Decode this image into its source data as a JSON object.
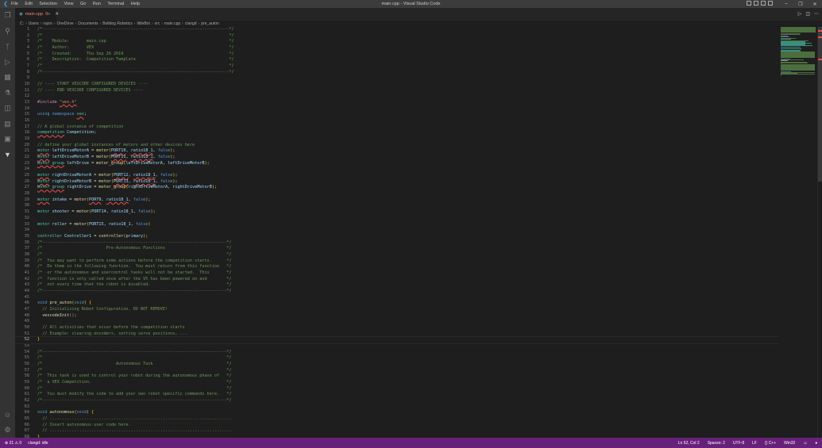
{
  "titlebar": {
    "title": "main.cpp - Visual Studio Code",
    "menu": [
      "File",
      "Edit",
      "Selection",
      "View",
      "Go",
      "Run",
      "Terminal",
      "Help"
    ]
  },
  "tab": {
    "label": "main.cpp",
    "badge": "9+"
  },
  "breadcrumb": [
    "C:",
    "Users",
    "rayro",
    "OneDrive",
    "Documents",
    "Bolldog Robotics",
    "littleBot",
    "src",
    "main.cpp",
    "clangd",
    "pre_auton"
  ],
  "status": {
    "errors": "21",
    "warnings": "0",
    "clangd": "clangd: idle",
    "position": "Ln 52, Col 2",
    "spaces": "Spaces: 2",
    "encoding": "UTF-8",
    "eol": "LF",
    "language": "C++",
    "platform": "Win32"
  },
  "editor": {
    "current_line": 52,
    "lines": [
      [
        [
          "c",
          "/*----------------------------------------------------------------------------*/"
        ]
      ],
      [
        [
          "c",
          "/*                                                                            */"
        ]
      ],
      [
        [
          "c",
          "/*    Module:       main.cpp                                                  */"
        ]
      ],
      [
        [
          "c",
          "/*    Author:       VEX                                                       */"
        ]
      ],
      [
        [
          "c",
          "/*    Created:      Thu Sep 26 2019                                           */"
        ]
      ],
      [
        [
          "c",
          "/*    Description:  Competition Template                                      */"
        ]
      ],
      [
        [
          "c",
          "/*                                                                            */"
        ]
      ],
      [
        [
          "c",
          "/*----------------------------------------------------------------------------*/"
        ]
      ],
      [],
      [
        [
          "c",
          "// ---- START VEXCODE CONFIGURED DEVICES ----"
        ]
      ],
      [
        [
          "c",
          "// ---- END VEXCODE CONFIGURED DEVICES ----"
        ]
      ],
      [],
      [
        [
          "m",
          "#include "
        ],
        [
          "s e",
          "\"vex.h\""
        ]
      ],
      [],
      [
        [
          "k",
          "using namespace "
        ],
        [
          "t e",
          "vex"
        ],
        [
          "p",
          ";"
        ]
      ],
      [],
      [
        [
          "c",
          "// A global instance of competition"
        ]
      ],
      [
        [
          "t e",
          "competition"
        ],
        [
          "p",
          " "
        ],
        [
          "v",
          "Competition"
        ],
        [
          "p",
          ";"
        ]
      ],
      [],
      [
        [
          "c",
          "// define your global instances of motors and other devices here"
        ]
      ],
      [
        [
          "t e",
          "motor"
        ],
        [
          "v",
          " leftDriveMotorA"
        ],
        [
          "p",
          " = "
        ],
        [
          "f",
          "motor"
        ],
        [
          "b",
          "("
        ],
        [
          "v e",
          "PORT10"
        ],
        [
          "p",
          ", "
        ],
        [
          "v e",
          "ratio18_1"
        ],
        [
          "p",
          ", "
        ],
        [
          "k",
          "false"
        ],
        [
          "b",
          ")"
        ],
        [
          "p",
          ";"
        ]
      ],
      [
        [
          "t e",
          "motor"
        ],
        [
          "v",
          " leftDriveMotorB"
        ],
        [
          "p",
          " = "
        ],
        [
          "f",
          "motor"
        ],
        [
          "b",
          "("
        ],
        [
          "v e",
          "PORT11"
        ],
        [
          "p",
          ", "
        ],
        [
          "v e",
          "ratio18_1"
        ],
        [
          "p",
          ", "
        ],
        [
          "k",
          "false"
        ],
        [
          "b",
          ")"
        ],
        [
          "p",
          ";"
        ]
      ],
      [
        [
          "t e",
          "motor_group"
        ],
        [
          "v",
          " leftDrive"
        ],
        [
          "p",
          " = "
        ],
        [
          "f",
          "motor_group"
        ],
        [
          "b",
          "("
        ],
        [
          "v",
          "leftDriveMotorA"
        ],
        [
          "p",
          ", "
        ],
        [
          "v",
          "leftDriveMotorB"
        ],
        [
          "b",
          ")"
        ],
        [
          "p",
          ";"
        ]
      ],
      [],
      [
        [
          "t e",
          "motor"
        ],
        [
          "v",
          " rightDriveMotorA"
        ],
        [
          "p",
          " = "
        ],
        [
          "f",
          "motor"
        ],
        [
          "b",
          "("
        ],
        [
          "v e",
          "PORT12"
        ],
        [
          "p",
          ", "
        ],
        [
          "v e",
          "ratio18_1"
        ],
        [
          "p",
          ", "
        ],
        [
          "k",
          "false"
        ],
        [
          "b",
          ")"
        ],
        [
          "p",
          ";"
        ]
      ],
      [
        [
          "t e",
          "motor"
        ],
        [
          "v",
          " rightDriveMotorB"
        ],
        [
          "p",
          " = "
        ],
        [
          "f",
          "motor"
        ],
        [
          "b",
          "("
        ],
        [
          "v e",
          "PORT13"
        ],
        [
          "p",
          ", "
        ],
        [
          "v e",
          "ratio18_1"
        ],
        [
          "p",
          ", "
        ],
        [
          "k",
          "false"
        ],
        [
          "b",
          ")"
        ],
        [
          "p",
          ";"
        ]
      ],
      [
        [
          "t e",
          "motor_group"
        ],
        [
          "v",
          " rightDrive"
        ],
        [
          "p",
          " = "
        ],
        [
          "f",
          "motor_group"
        ],
        [
          "b",
          "("
        ],
        [
          "v",
          "rightDriveMotorA"
        ],
        [
          "p",
          ", "
        ],
        [
          "v",
          "rightDriveMotorB"
        ],
        [
          "b",
          ")"
        ],
        [
          "p",
          ";"
        ]
      ],
      [],
      [
        [
          "t e",
          "motor"
        ],
        [
          "v",
          " intake"
        ],
        [
          "p",
          " = "
        ],
        [
          "f",
          "motor"
        ],
        [
          "b",
          "("
        ],
        [
          "v e",
          "PORT9"
        ],
        [
          "p",
          ", "
        ],
        [
          "v e",
          "ratio18_1"
        ],
        [
          "p",
          ", "
        ],
        [
          "k",
          "false"
        ],
        [
          "b",
          ")"
        ],
        [
          "p",
          ";"
        ]
      ],
      [],
      [
        [
          "t",
          "motor"
        ],
        [
          "v",
          " shooter"
        ],
        [
          "p",
          " = "
        ],
        [
          "f",
          "motor"
        ],
        [
          "b",
          "("
        ],
        [
          "v",
          "PORT14"
        ],
        [
          "p",
          ", "
        ],
        [
          "v",
          "ratio18_1"
        ],
        [
          "p",
          ", "
        ],
        [
          "k",
          "false"
        ],
        [
          "b",
          ")"
        ],
        [
          "p",
          ";"
        ]
      ],
      [],
      [
        [
          "t",
          "motor"
        ],
        [
          "v",
          " roller"
        ],
        [
          "p",
          " = "
        ],
        [
          "f",
          "motor"
        ],
        [
          "b",
          "("
        ],
        [
          "v",
          "PORT15"
        ],
        [
          "p",
          ", "
        ],
        [
          "v",
          "ratio18_1"
        ],
        [
          "p",
          ", "
        ],
        [
          "k",
          "false"
        ],
        [
          "b",
          ")"
        ]
      ],
      [],
      [
        [
          "t",
          "controller"
        ],
        [
          "v",
          " Controller1"
        ],
        [
          "p",
          " = "
        ],
        [
          "f",
          "controller"
        ],
        [
          "b",
          "("
        ],
        [
          "v",
          "primary"
        ],
        [
          "b",
          ")"
        ],
        [
          "p",
          ";"
        ]
      ],
      [
        [
          "c",
          "/*---------------------------------------------------------------------------*/"
        ]
      ],
      [
        [
          "c",
          "/*                          Pre-Autonomous Functions                         */"
        ]
      ],
      [
        [
          "c",
          "/*                                                                           */"
        ]
      ],
      [
        [
          "c",
          "/*  You may want to perform some actions before the competition starts.      */"
        ]
      ],
      [
        [
          "c",
          "/*  Do them in the following function.  You must return from this function   */"
        ]
      ],
      [
        [
          "c",
          "/*  or the autonomous and usercontrol tasks will not be started.  This       */"
        ]
      ],
      [
        [
          "c",
          "/*  function is only called once after the V5 has been powered on and        */"
        ]
      ],
      [
        [
          "c",
          "/*  not every time that the robot is disabled.                               */"
        ]
      ],
      [
        [
          "c",
          "/*---------------------------------------------------------------------------*/"
        ]
      ],
      [],
      [
        [
          "k",
          "void "
        ],
        [
          "f",
          "pre_auton"
        ],
        [
          "b",
          "("
        ],
        [
          "k",
          "void"
        ],
        [
          "b",
          ")"
        ],
        [
          "p",
          " "
        ],
        [
          "b",
          "{"
        ]
      ],
      [
        [
          "c",
          "  // Initializing Robot Configuration. DO NOT REMOVE!"
        ]
      ],
      [
        [
          "f",
          "  vexcodeInit"
        ],
        [
          "m",
          "()"
        ],
        [
          "p",
          ";"
        ]
      ],
      [],
      [
        [
          "c",
          "  // All activities that occur before the competition starts"
        ]
      ],
      [
        [
          "c",
          "  // Example: clearing encoders, setting servo positions, ..."
        ]
      ],
      [
        [
          "b",
          "}"
        ]
      ],
      [],
      [
        [
          "c",
          "/*---------------------------------------------------------------------------*/"
        ]
      ],
      [
        [
          "c",
          "/*                                                                           */"
        ]
      ],
      [
        [
          "c",
          "/*                              Autonomous Task                              */"
        ]
      ],
      [
        [
          "c",
          "/*                                                                           */"
        ]
      ],
      [
        [
          "c",
          "/*  This task is used to control your robot during the autonomous phase of   */"
        ]
      ],
      [
        [
          "c",
          "/*  a VEX Competition.                                                       */"
        ]
      ],
      [
        [
          "c",
          "/*                                                                           */"
        ]
      ],
      [
        [
          "c",
          "/*  You must modify the code to add your own robot specific commands here.   */"
        ]
      ],
      [
        [
          "c",
          "/*---------------------------------------------------------------------------*/"
        ]
      ],
      [],
      [
        [
          "k",
          "void "
        ],
        [
          "f",
          "autonomous"
        ],
        [
          "b",
          "("
        ],
        [
          "k",
          "void"
        ],
        [
          "b",
          ")"
        ],
        [
          "p",
          " "
        ],
        [
          "b",
          "{"
        ]
      ],
      [
        [
          "c",
          "  // .........................................................................."
        ]
      ],
      [
        [
          "c",
          "  // Insert autonomous user code here."
        ]
      ],
      [
        [
          "c",
          "  // .........................................................................."
        ]
      ],
      [
        [
          "b",
          "}"
        ]
      ]
    ]
  }
}
